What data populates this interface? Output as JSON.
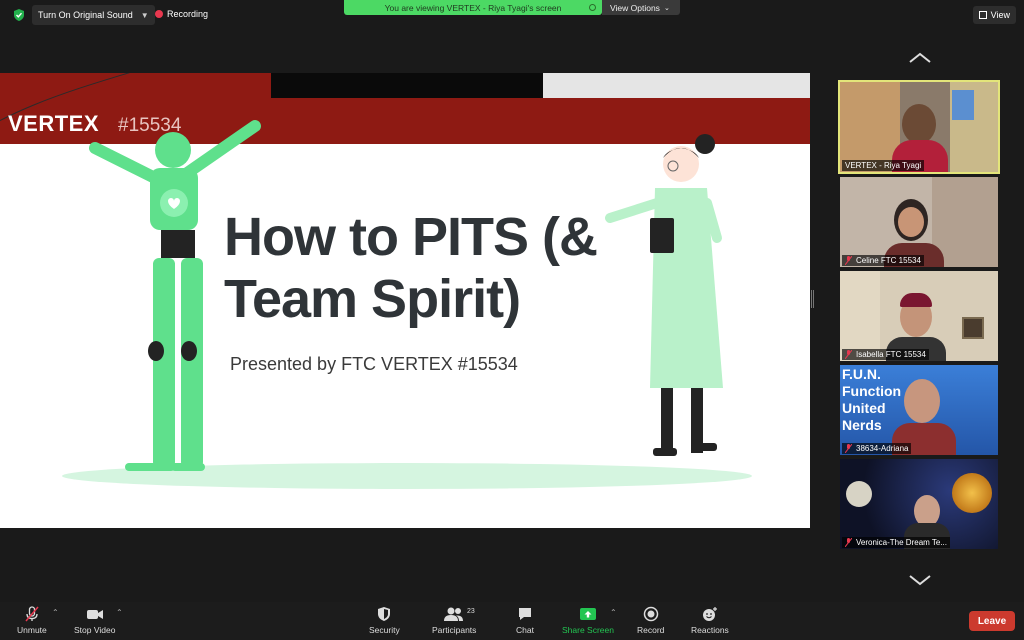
{
  "topbar": {
    "original_sound_label": "Turn On Original Sound",
    "recording_label": "Recording",
    "viewing_banner": "You are viewing VERTEX - Riya Tyagi's screen",
    "view_options_label": "View Options",
    "view_label": "View"
  },
  "slide": {
    "logo": "VERTEX",
    "logo_number": "#15534",
    "title_line1": "How to PITS (&",
    "title_line2": "Team Spirit)",
    "subtitle": "Presented by FTC VERTEX #15534"
  },
  "participants": [
    {
      "name": "VERTEX - Riya Tyagi",
      "muted": false,
      "active": true
    },
    {
      "name": "Celine FTC 15534",
      "muted": true,
      "active": false
    },
    {
      "name": "Isabella FTC 15534",
      "muted": true,
      "active": false
    },
    {
      "name": "38634-Adriana",
      "muted": true,
      "active": false,
      "overlay_text": [
        "F.U.N.",
        "Function",
        "United",
        "Nerds"
      ]
    },
    {
      "name": "Veronica-The Dream Te...",
      "muted": true,
      "active": false
    }
  ],
  "toolbar": {
    "unmute_label": "Unmute",
    "stop_video_label": "Stop Video",
    "security_label": "Security",
    "participants_label": "Participants",
    "participants_count": "23",
    "chat_label": "Chat",
    "share_screen_label": "Share Screen",
    "record_label": "Record",
    "reactions_label": "Reactions",
    "leave_label": "Leave"
  },
  "colors": {
    "banner_green": "#4cd964",
    "slide_red": "#8e1a13",
    "robot_green": "#5fe08c",
    "leave_red": "#cc3a2e",
    "active_speaker": "#e3e57a"
  }
}
